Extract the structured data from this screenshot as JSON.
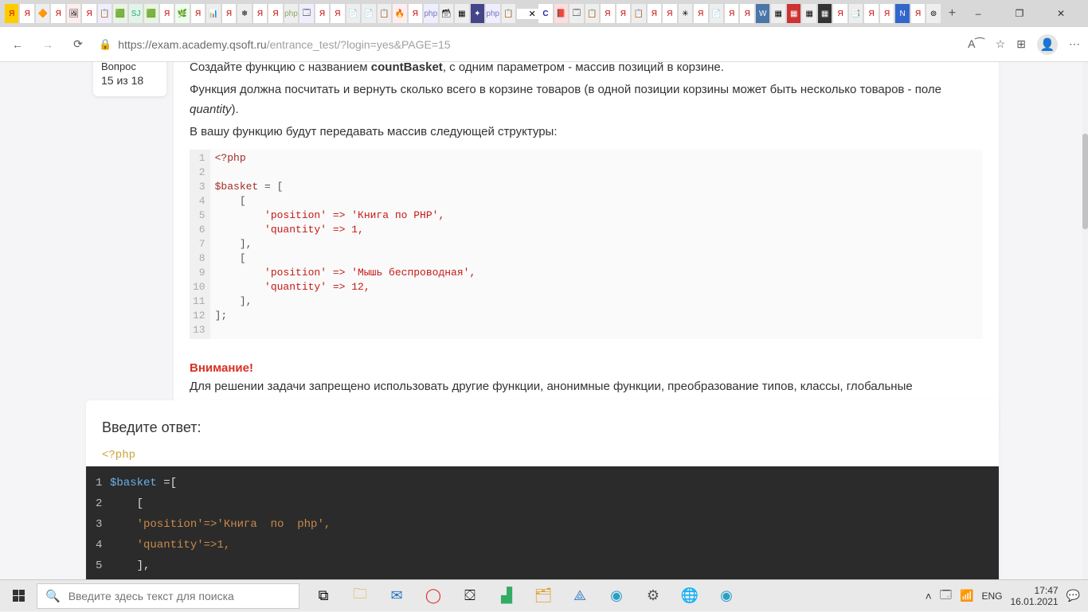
{
  "window": {
    "minimize": "–",
    "maximize": "❐",
    "close": "✕"
  },
  "browser": {
    "url_host": "https://exam.academy.qsoft.ru",
    "url_path": "/entrance_test/?login=yes&PAGE=15",
    "active_tab_close": "✕",
    "new_tab": "+"
  },
  "question": {
    "label": "Вопрос",
    "counter": "15 из 18"
  },
  "task": {
    "p1a": "Создайте функцию с названием ",
    "p1b": "countBasket",
    "p1c": ", с одним параметром - массив позиций в корзине.",
    "p2a": "Функция должна посчитать и вернуть сколько всего в корзине товаров (в одной позиции корзины может быть несколько товаров - поле ",
    "p2b": "quantity",
    "p2c": ").",
    "p3": "В вашу функцию будут передавать массив следующей структуры:",
    "warn_title": "Внимание!",
    "warn_text": "Для решении задачи запрещено использовать другие функции, анонимные функции, преобразование типов, классы, глобальные переменные"
  },
  "code": {
    "l1": "<?php",
    "l2": "",
    "l3_var": "$basket",
    "l3_rest": " = [",
    "l4": "    [",
    "l5": "        'position' => 'Книга по PHP',",
    "l6": "        'quantity' => 1,",
    "l7": "    ],",
    "l8": "    [",
    "l9": "        'position' => 'Мышь беспроводная',",
    "l10": "        'quantity' => 12,",
    "l11": "    ],",
    "l12": "];",
    "l13": ""
  },
  "answer": {
    "title": "Введите ответ:",
    "php_open": "<?php",
    "lines": [
      {
        "n": "1",
        "var": "$basket",
        "rest": " =["
      },
      {
        "n": "2",
        "var": "",
        "rest": "    ["
      },
      {
        "n": "3",
        "var": "",
        "rest": "    'position'=>'Книга  по  php',"
      },
      {
        "n": "4",
        "var": "",
        "rest": "    'quantity'=>1,"
      },
      {
        "n": "5",
        "var": "",
        "rest": "    ],"
      }
    ]
  },
  "taskbar": {
    "search_placeholder": "Введите здесь текст для поиска",
    "lang": "ENG",
    "time": "17:47",
    "date": "16.01.2021"
  }
}
